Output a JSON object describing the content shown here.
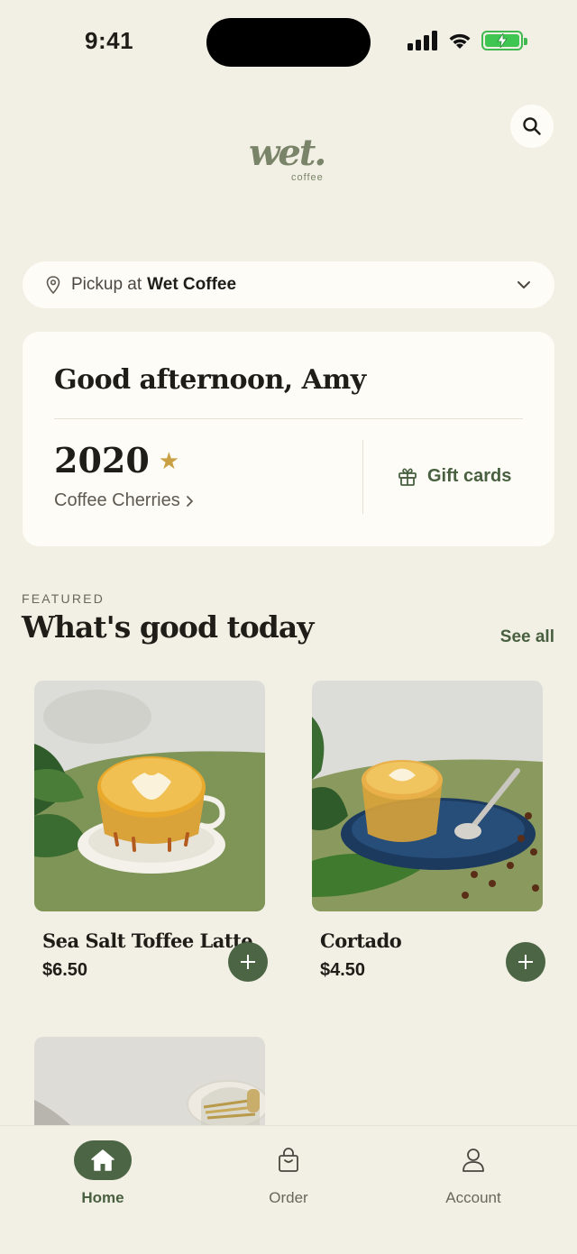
{
  "status_bar": {
    "time": "9:41",
    "battery_state": "charging"
  },
  "brand": {
    "logo_word": "wet.",
    "logo_sub": "coffee",
    "color": "#7a8468"
  },
  "pickup": {
    "prefix": "Pickup at",
    "store": "Wet Coffee"
  },
  "rewards": {
    "greeting": "Good afternoon, Amy",
    "points": "2020",
    "points_label": "Coffee Cherries",
    "gift_label": "Gift cards"
  },
  "featured": {
    "eyebrow": "FEATURED",
    "title": "What's good today",
    "see_all": "See all",
    "items": [
      {
        "name": "Sea Salt Toffee Latte",
        "price": "$6.50"
      },
      {
        "name": "Cortado",
        "price": "$4.50"
      },
      {
        "name": "",
        "price": ""
      }
    ]
  },
  "tabs": [
    {
      "label": "Home",
      "icon": "home-icon",
      "active": true
    },
    {
      "label": "Order",
      "icon": "bag-icon",
      "active": false
    },
    {
      "label": "Account",
      "icon": "person-icon",
      "active": false
    }
  ],
  "colors": {
    "accent": "#4c6545",
    "background": "#f2efe4",
    "card": "#fdfcf7",
    "star": "#c9a043"
  }
}
